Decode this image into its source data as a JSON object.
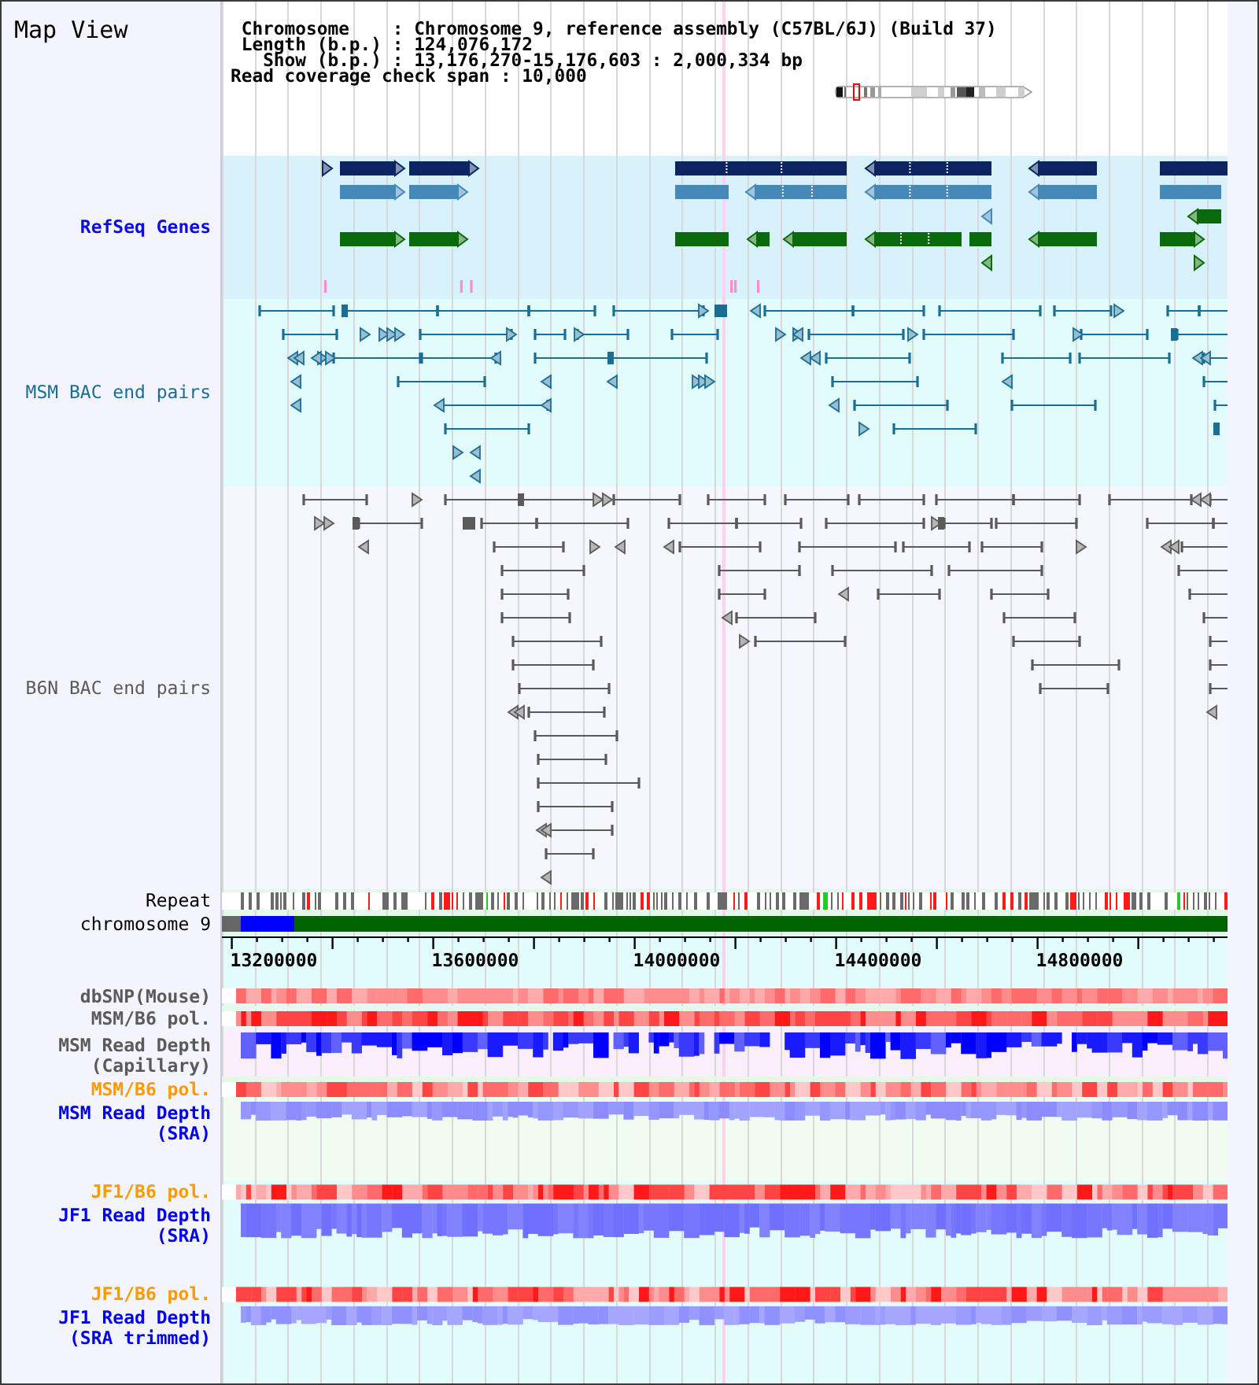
{
  "window": {
    "title": "Map View"
  },
  "info": {
    "rows": [
      {
        "label": "Chromosome    :",
        "value": "Chromosome 9, reference assembly (C57BL/6J) (Build 37)"
      },
      {
        "label": "Length (b.p.) :",
        "value": "124,076,172"
      },
      {
        "label": "Show (b.p.) :",
        "value": "13,176,270-15,176,603 : 2,000,334 bp"
      }
    ],
    "coverage": {
      "label": "Read coverage check span :",
      "value": "10,000"
    }
  },
  "tracks": [
    {
      "label": "RefSeq Genes",
      "kind": "genes",
      "color": "#0a0aee"
    },
    {
      "label": "MSM BAC end pairs",
      "kind": "bac",
      "color": "#1a6e96"
    },
    {
      "label": "B6N BAC end pairs",
      "kind": "bac",
      "color": "#5a5a5a"
    },
    {
      "label": "Repeat",
      "kind": "repeat",
      "color": "#000000"
    },
    {
      "label": "chromosome 9",
      "kind": "chromosome",
      "color": "#000000"
    }
  ],
  "axis": {
    "ticks": [
      "13200000",
      "13600000",
      "14000000",
      "14400000",
      "14800000"
    ]
  },
  "data_tracks": [
    {
      "label": "dbSNP(Mouse)",
      "kind": "heat",
      "color": "#5a5a5a"
    },
    {
      "label": "MSM/B6 pol.",
      "kind": "heat",
      "color": "#5a5a5a"
    },
    {
      "label": "MSM Read Depth",
      "note": "(Capillary)",
      "kind": "depth",
      "color": "#5a5a5a"
    },
    {
      "label": "MSM/B6 pol.",
      "kind": "heat",
      "color": "#ff9900"
    },
    {
      "label": "MSM Read Depth",
      "note": "(SRA)",
      "kind": "depth",
      "color": "#0000ee"
    },
    {
      "label": "JF1/B6 pol.",
      "kind": "heat",
      "color": "#ff9900"
    },
    {
      "label": "JF1 Read Depth",
      "note": "(SRA)",
      "kind": "depth",
      "color": "#0000ee"
    },
    {
      "label": "JF1/B6 pol.",
      "kind": "heat",
      "color": "#ff9900"
    },
    {
      "label": "JF1 Read Depth",
      "note": "(SRA trimmed)",
      "kind": "depth",
      "color": "#0000ee"
    }
  ]
}
